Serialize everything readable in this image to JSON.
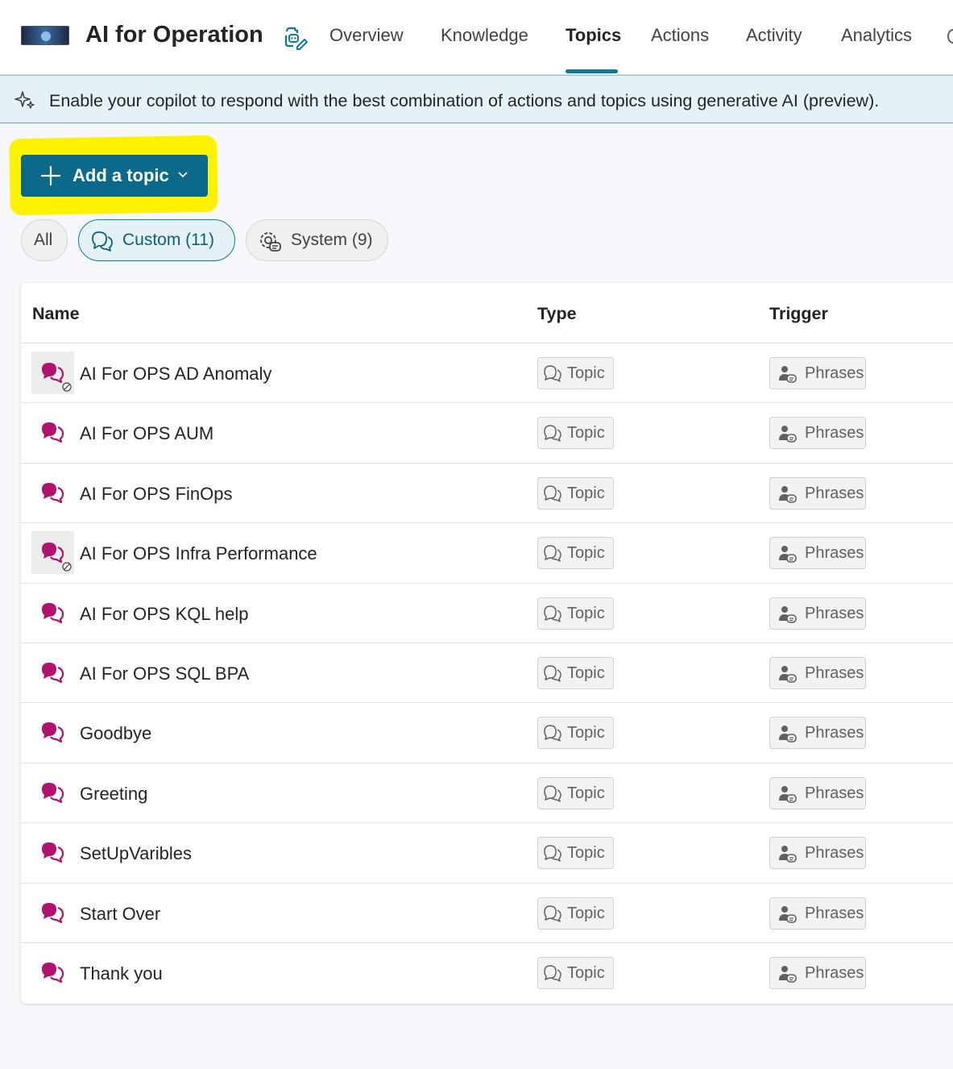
{
  "header": {
    "app_title": "AI for Operation",
    "tabs": [
      {
        "label": "Overview",
        "active": false
      },
      {
        "label": "Knowledge",
        "active": false
      },
      {
        "label": "Topics",
        "active": true
      },
      {
        "label": "Actions",
        "active": false
      },
      {
        "label": "Activity",
        "active": false
      },
      {
        "label": "Analytics",
        "active": false
      }
    ]
  },
  "banner": {
    "text": "Enable your copilot to respond with the best combination of actions and topics using generative AI (preview)."
  },
  "toolbar": {
    "add_topic_label": "Add a topic"
  },
  "filters": [
    {
      "label": "All",
      "selected": false
    },
    {
      "label": "Custom (11)",
      "selected": true
    },
    {
      "label": "System (9)",
      "selected": false
    }
  ],
  "table": {
    "columns": [
      "Name",
      "Type",
      "Trigger"
    ],
    "rows": [
      {
        "name": "AI For OPS AD Anomaly",
        "type": "Topic",
        "trigger": "Phrases",
        "disabled": true
      },
      {
        "name": "AI For OPS AUM",
        "type": "Topic",
        "trigger": "Phrases",
        "disabled": false
      },
      {
        "name": "AI For OPS FinOps",
        "type": "Topic",
        "trigger": "Phrases",
        "disabled": false
      },
      {
        "name": "AI For OPS Infra Performance",
        "type": "Topic",
        "trigger": "Phrases",
        "disabled": true
      },
      {
        "name": "AI For OPS KQL help",
        "type": "Topic",
        "trigger": "Phrases",
        "disabled": false
      },
      {
        "name": "AI For OPS SQL BPA",
        "type": "Topic",
        "trigger": "Phrases",
        "disabled": false
      },
      {
        "name": "Goodbye",
        "type": "Topic",
        "trigger": "Phrases",
        "disabled": false
      },
      {
        "name": "Greeting",
        "type": "Topic",
        "trigger": "Phrases",
        "disabled": false
      },
      {
        "name": "SetUpVaribles",
        "type": "Topic",
        "trigger": "Phrases",
        "disabled": false
      },
      {
        "name": "Start Over",
        "type": "Topic",
        "trigger": "Phrases",
        "disabled": false
      },
      {
        "name": "Thank you",
        "type": "Topic",
        "trigger": "Phrases",
        "disabled": false
      }
    ]
  },
  "icons": {
    "topic_icon": "chat-bubbles-icon",
    "type_icon": "chat-outline-icon",
    "trigger_icon": "person-chat-icon",
    "disabled_icon": "ban-icon"
  },
  "colors": {
    "accent": "#0f7a95",
    "add_button": "#0b6a8a",
    "topic_icon": "#b0126e",
    "highlight": "#fff200"
  }
}
